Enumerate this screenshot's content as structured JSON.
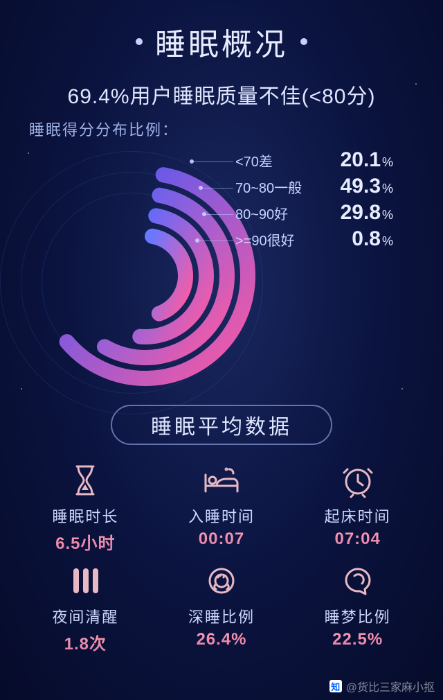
{
  "title": "睡眠概况",
  "headline": "69.4%用户睡眠质量不佳(<80分)",
  "subhead": "睡眠得分分布比例：",
  "legend_pct_suffix": "%",
  "chart_data": {
    "type": "pie",
    "title": "睡眠得分分布比例",
    "categories": [
      "<70差",
      "70~80一般",
      "80~90好",
      ">=90很好"
    ],
    "values": [
      20.1,
      49.3,
      29.8,
      0.8
    ],
    "unit": "%"
  },
  "arcs": [
    {
      "label": "<70差",
      "value": "20.1",
      "r": 148,
      "deg": 220,
      "grad_from": "#3b59ff",
      "grad_to": "#ff5aa0"
    },
    {
      "label": "70~80一般",
      "value": "49.3",
      "r": 118,
      "deg": 200,
      "grad_from": "#4a63ff",
      "grad_to": "#ff5aa0"
    },
    {
      "label": "80~90好",
      "value": "29.8",
      "r": 88,
      "deg": 175,
      "grad_from": "#5a6bff",
      "grad_to": "#ff5aa0"
    },
    {
      "label": ">=90很好",
      "value": "0.8",
      "r": 58,
      "deg": 150,
      "grad_from": "#6a77ff",
      "grad_to": "#ff5aa0"
    }
  ],
  "section2_title": "睡眠平均数据",
  "stats": [
    {
      "icon": "hourglass-icon",
      "label": "睡眠时长",
      "value": "6.5小时"
    },
    {
      "icon": "bed-icon",
      "label": "入睡时间",
      "value": "00:07"
    },
    {
      "icon": "alarm-icon",
      "label": "起床时间",
      "value": "07:04"
    },
    {
      "icon": "tally-icon",
      "label": "夜间清醒",
      "value": "1.8次"
    },
    {
      "icon": "sheep-icon",
      "label": "深睡比例",
      "value": "26.4%"
    },
    {
      "icon": "brain-icon",
      "label": "睡梦比例",
      "value": "22.5%"
    }
  ],
  "watermark": {
    "logo": "知",
    "text": "@货比三家麻小抠"
  }
}
